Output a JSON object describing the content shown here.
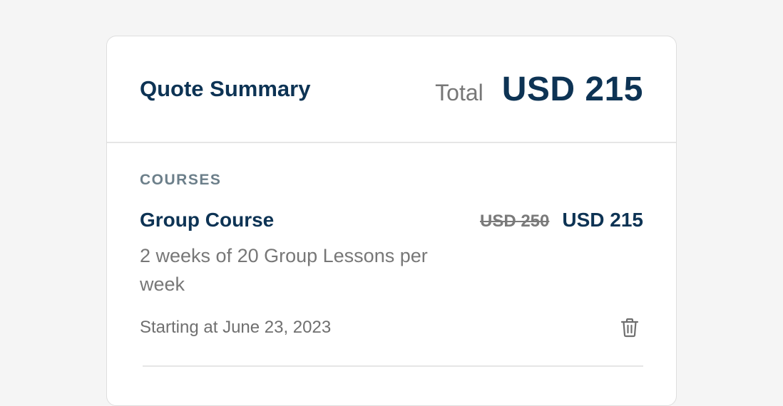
{
  "header": {
    "title": "Quote Summary",
    "total_label": "Total",
    "total_amount": "USD 215"
  },
  "courses": {
    "section_label": "COURSES",
    "items": [
      {
        "name": "Group Course",
        "original_price": "USD 250",
        "price": "USD 215",
        "description": "2 weeks of 20 Group Lessons per week",
        "start": "Starting at June 23, 2023",
        "remove_icon": "trash-icon"
      }
    ]
  },
  "colors": {
    "primary": "#0d3354",
    "muted": "#777777",
    "section_label": "#6c7f8a",
    "background": "#f5f5f5"
  }
}
